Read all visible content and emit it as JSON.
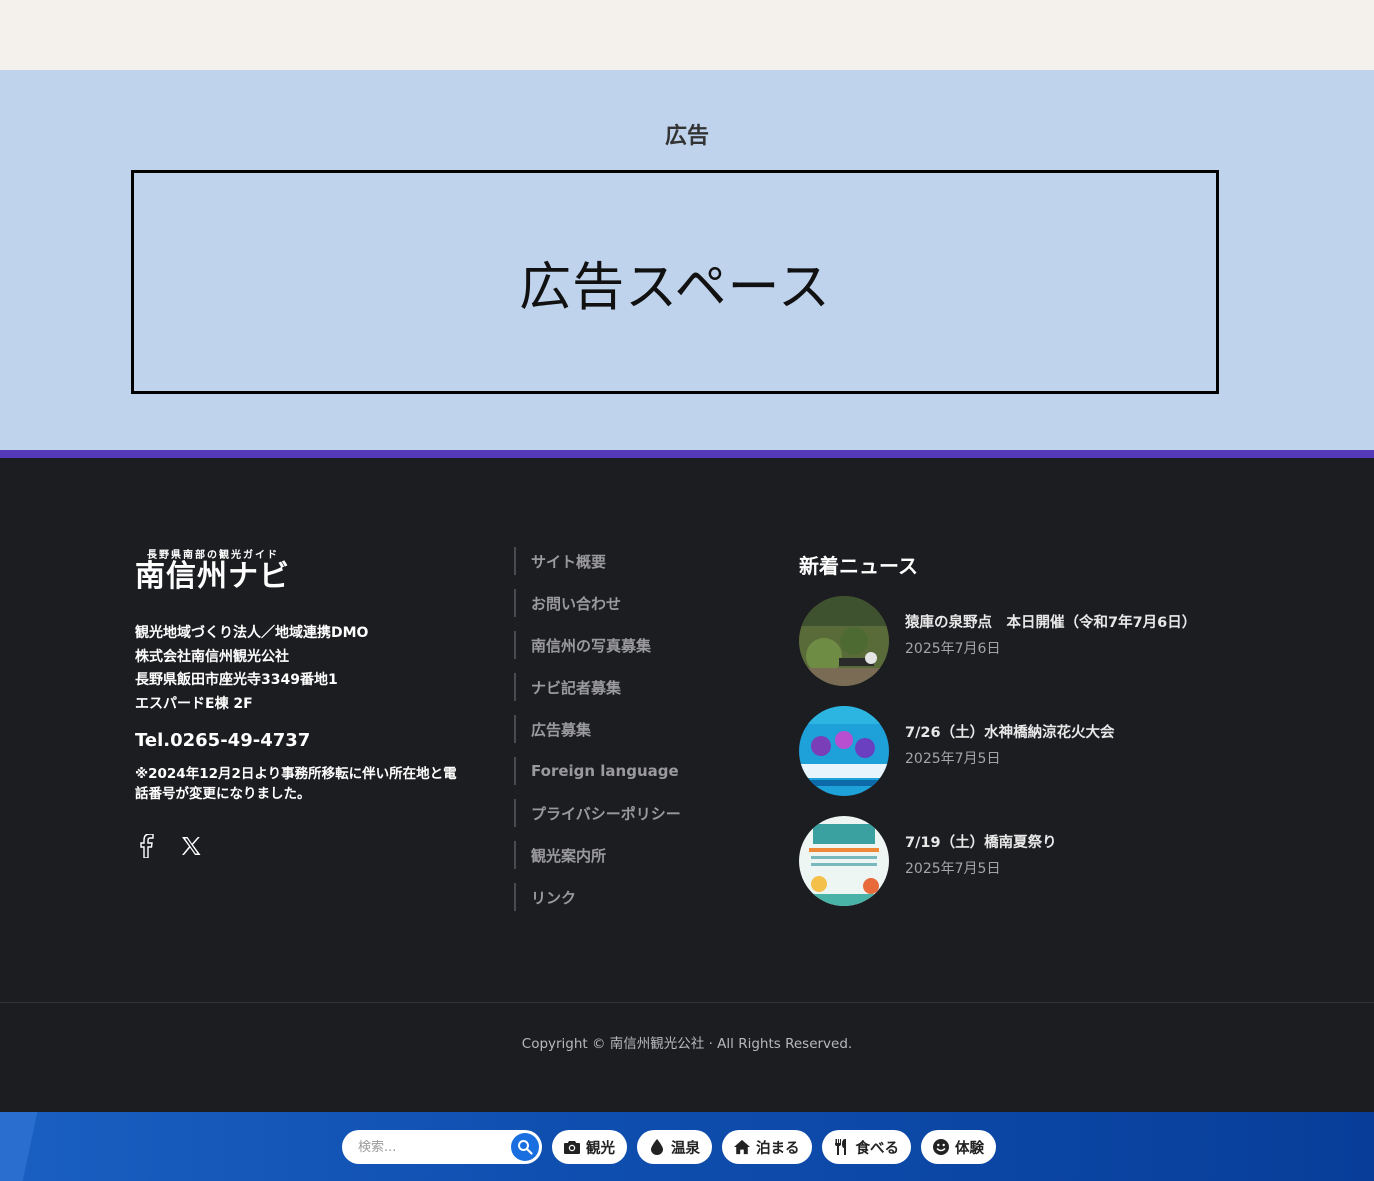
{
  "ad": {
    "heading": "広告",
    "space_label": "広告スペース"
  },
  "footer": {
    "logo": {
      "sub": "長野県南部の観光ガイド",
      "main": "南信州ナビ"
    },
    "org_lines": [
      "観光地域づくり法人／地域連携DMO",
      "株式会社南信州観光公社",
      "長野県飯田市座光寺3349番地1",
      "エスパードE棟 2F"
    ],
    "tel": "Tel.0265-49-4737",
    "note": "※2024年12月2日より事務所移転に伴い所在地と電話番号が変更になりました。",
    "social": [
      {
        "icon": "facebook-icon"
      },
      {
        "icon": "x-icon"
      }
    ],
    "links": [
      "サイト概要",
      "お問い合わせ",
      "南信州の写真募集",
      "ナビ記者募集",
      "広告募集",
      "Foreign language",
      "プライバシーポリシー",
      "観光案内所",
      "リンク"
    ],
    "news": {
      "title": "新着ニュース",
      "items": [
        {
          "headline": "猿庫の泉野点　本日開催（令和7年7月6日）",
          "date": "2025年7月6日"
        },
        {
          "headline": "7/26（土）水神橋納涼花火大会",
          "date": "2025年7月5日"
        },
        {
          "headline": "7/19（土）橋南夏祭り",
          "date": "2025年7月5日"
        }
      ]
    },
    "copyright": "Copyright © 南信州観光公社 · All Rights Reserved."
  },
  "bottom_bar": {
    "search_placeholder": "検索...",
    "categories": [
      {
        "label": "観光",
        "icon": "camera-icon"
      },
      {
        "label": "温泉",
        "icon": "water-drop-icon"
      },
      {
        "label": "泊まる",
        "icon": "home-icon"
      },
      {
        "label": "食べる",
        "icon": "utensils-icon"
      },
      {
        "label": "体験",
        "icon": "smile-icon"
      }
    ]
  },
  "colors": {
    "accent": "#5439b8",
    "ad_bg": "#bfd3ec",
    "footer_bg": "#1c1d21",
    "bar_blue": "#0f4fb0"
  }
}
